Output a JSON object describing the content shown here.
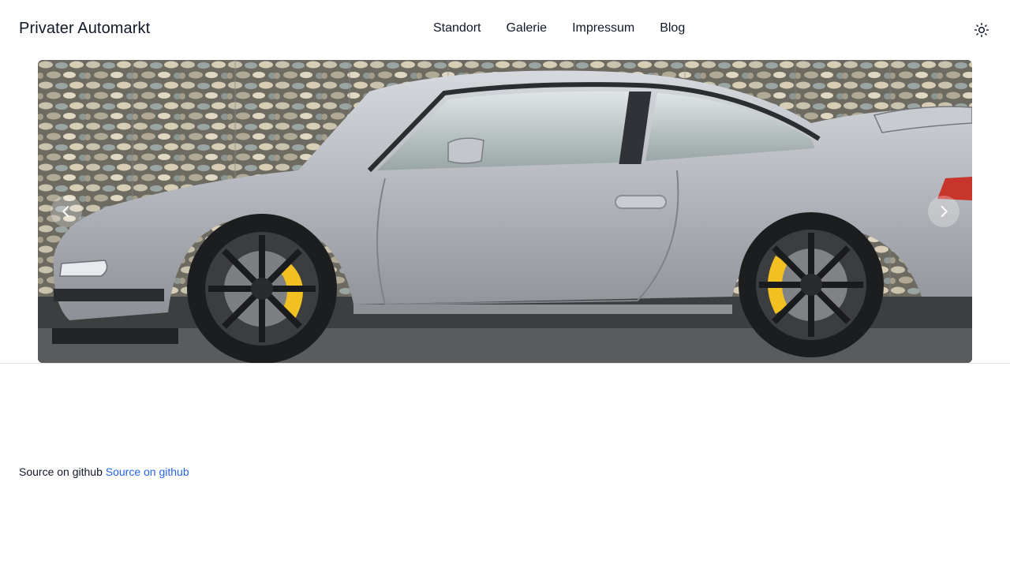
{
  "header": {
    "brand": "Privater Automarkt",
    "nav": [
      "Standort",
      "Galerie",
      "Impressum",
      "Blog"
    ],
    "theme_icon": "sun-icon"
  },
  "carousel": {
    "image_subject": "silver sports car parked in front of a stone gabion wall",
    "prev_icon": "chevron-left-icon",
    "next_icon": "chevron-right-icon"
  },
  "footer": {
    "text": "Source on github",
    "link_text": "Source on github"
  },
  "colors": {
    "text": "#111827",
    "link": "#2563eb",
    "divider": "#e5e7eb",
    "caliper": "#f2c020",
    "car_body": "#b9bcc2"
  }
}
